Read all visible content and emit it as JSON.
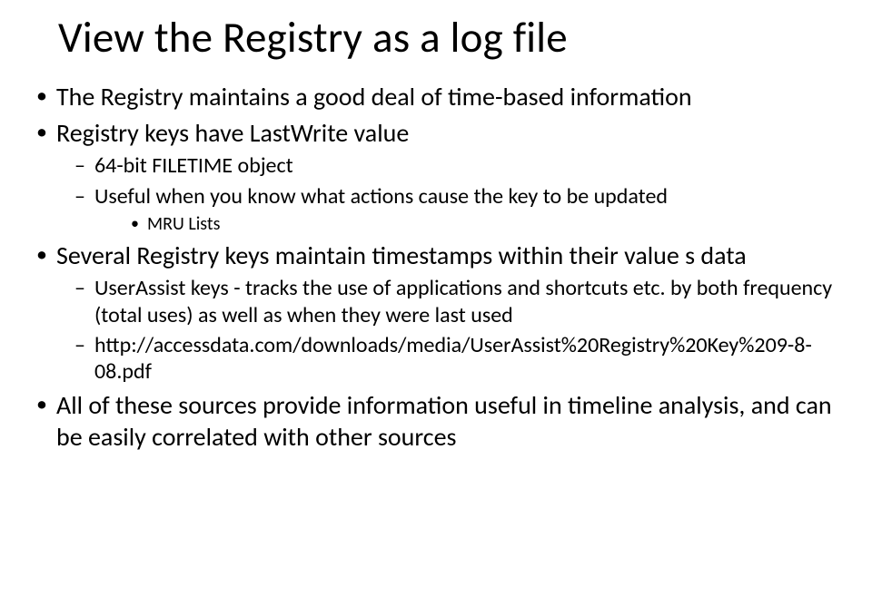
{
  "title": "View the Registry as a log file",
  "bullets": {
    "b1": "The Registry maintains a good deal of time-based information",
    "b2": "Registry keys have LastWrite value",
    "b2a": "64-bit FILETIME object",
    "b2b": "Useful when you know what actions cause the key to be updated",
    "b2b1": "MRU Lists",
    "b3": "Several Registry keys maintain timestamps within their value s data",
    "b3a": "UserAssist keys - tracks the use of applications and shortcuts etc. by both frequency (total uses) as well as when they were last used",
    "b3b": "http://accessdata.com/downloads/media/UserAssist%20Registry%20Key%209-8-08.pdf",
    "b4": "All of these sources provide information useful in timeline analysis, and can be easily correlated with other sources"
  }
}
